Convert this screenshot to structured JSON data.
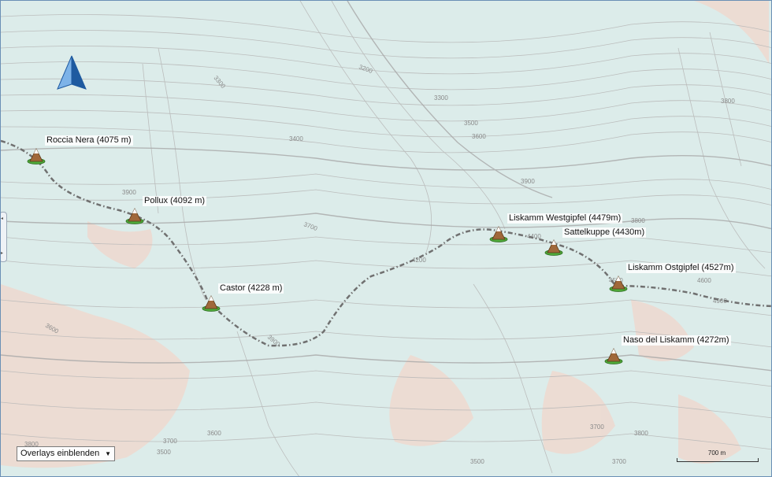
{
  "peaks": [
    {
      "id": "roccia-nera",
      "label": "Roccia Nera (4075 m)"
    },
    {
      "id": "pollux",
      "label": "Pollux (4092 m)"
    },
    {
      "id": "castor",
      "label": "Castor (4228 m)"
    },
    {
      "id": "liskamm-westgipfel",
      "label": "Liskamm Westgipfel (4479m)"
    },
    {
      "id": "sattelkuppe",
      "label": "Sattelkuppe (4430m)"
    },
    {
      "id": "liskamm-ostgipfel",
      "label": "Liskamm Ostgipfel (4527m)"
    },
    {
      "id": "naso-del-liskamm",
      "label": "Naso del Liskamm (4272m)"
    }
  ],
  "contour_labels": [
    "3300",
    "3200",
    "3300",
    "3500",
    "3600",
    "3800",
    "3400",
    "3900",
    "3900",
    "3800",
    "3700",
    "4200",
    "4400",
    "4500",
    "4600",
    "4900",
    "3600",
    "3900",
    "3700",
    "3600",
    "3500",
    "3700",
    "3800",
    "3800",
    "3700",
    "3500"
  ],
  "controls": {
    "overlay_select": "Overlays einblenden",
    "scale_label": "700 m"
  },
  "colors": {
    "terrain_bg": "#dcecea",
    "contour": "#b8b8b8",
    "route": "#707070",
    "glacier_shade": "#eed9cf"
  }
}
